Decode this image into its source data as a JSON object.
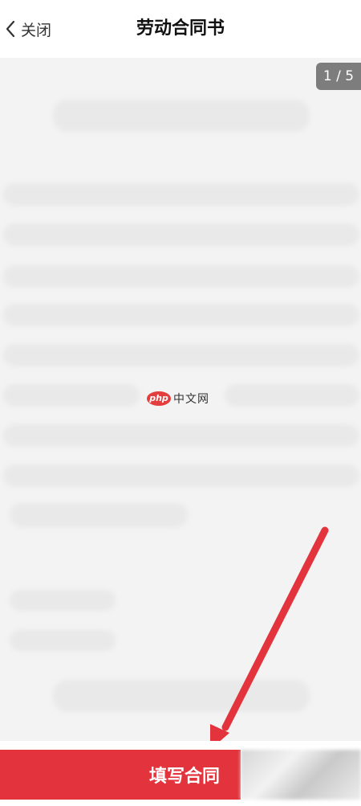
{
  "header": {
    "back_icon": "chevron-left-icon",
    "back_label": "关闭",
    "title": "劳动合同书"
  },
  "document": {
    "page_indicator": "1 / 5"
  },
  "watermark": {
    "logo_text": "php",
    "site_text": "中文网"
  },
  "footer": {
    "fill_button_label": "填写合同"
  },
  "colors": {
    "accent": "#e3333d",
    "arrow": "#e3333d",
    "indicator_bg": "#7d7d7d"
  }
}
